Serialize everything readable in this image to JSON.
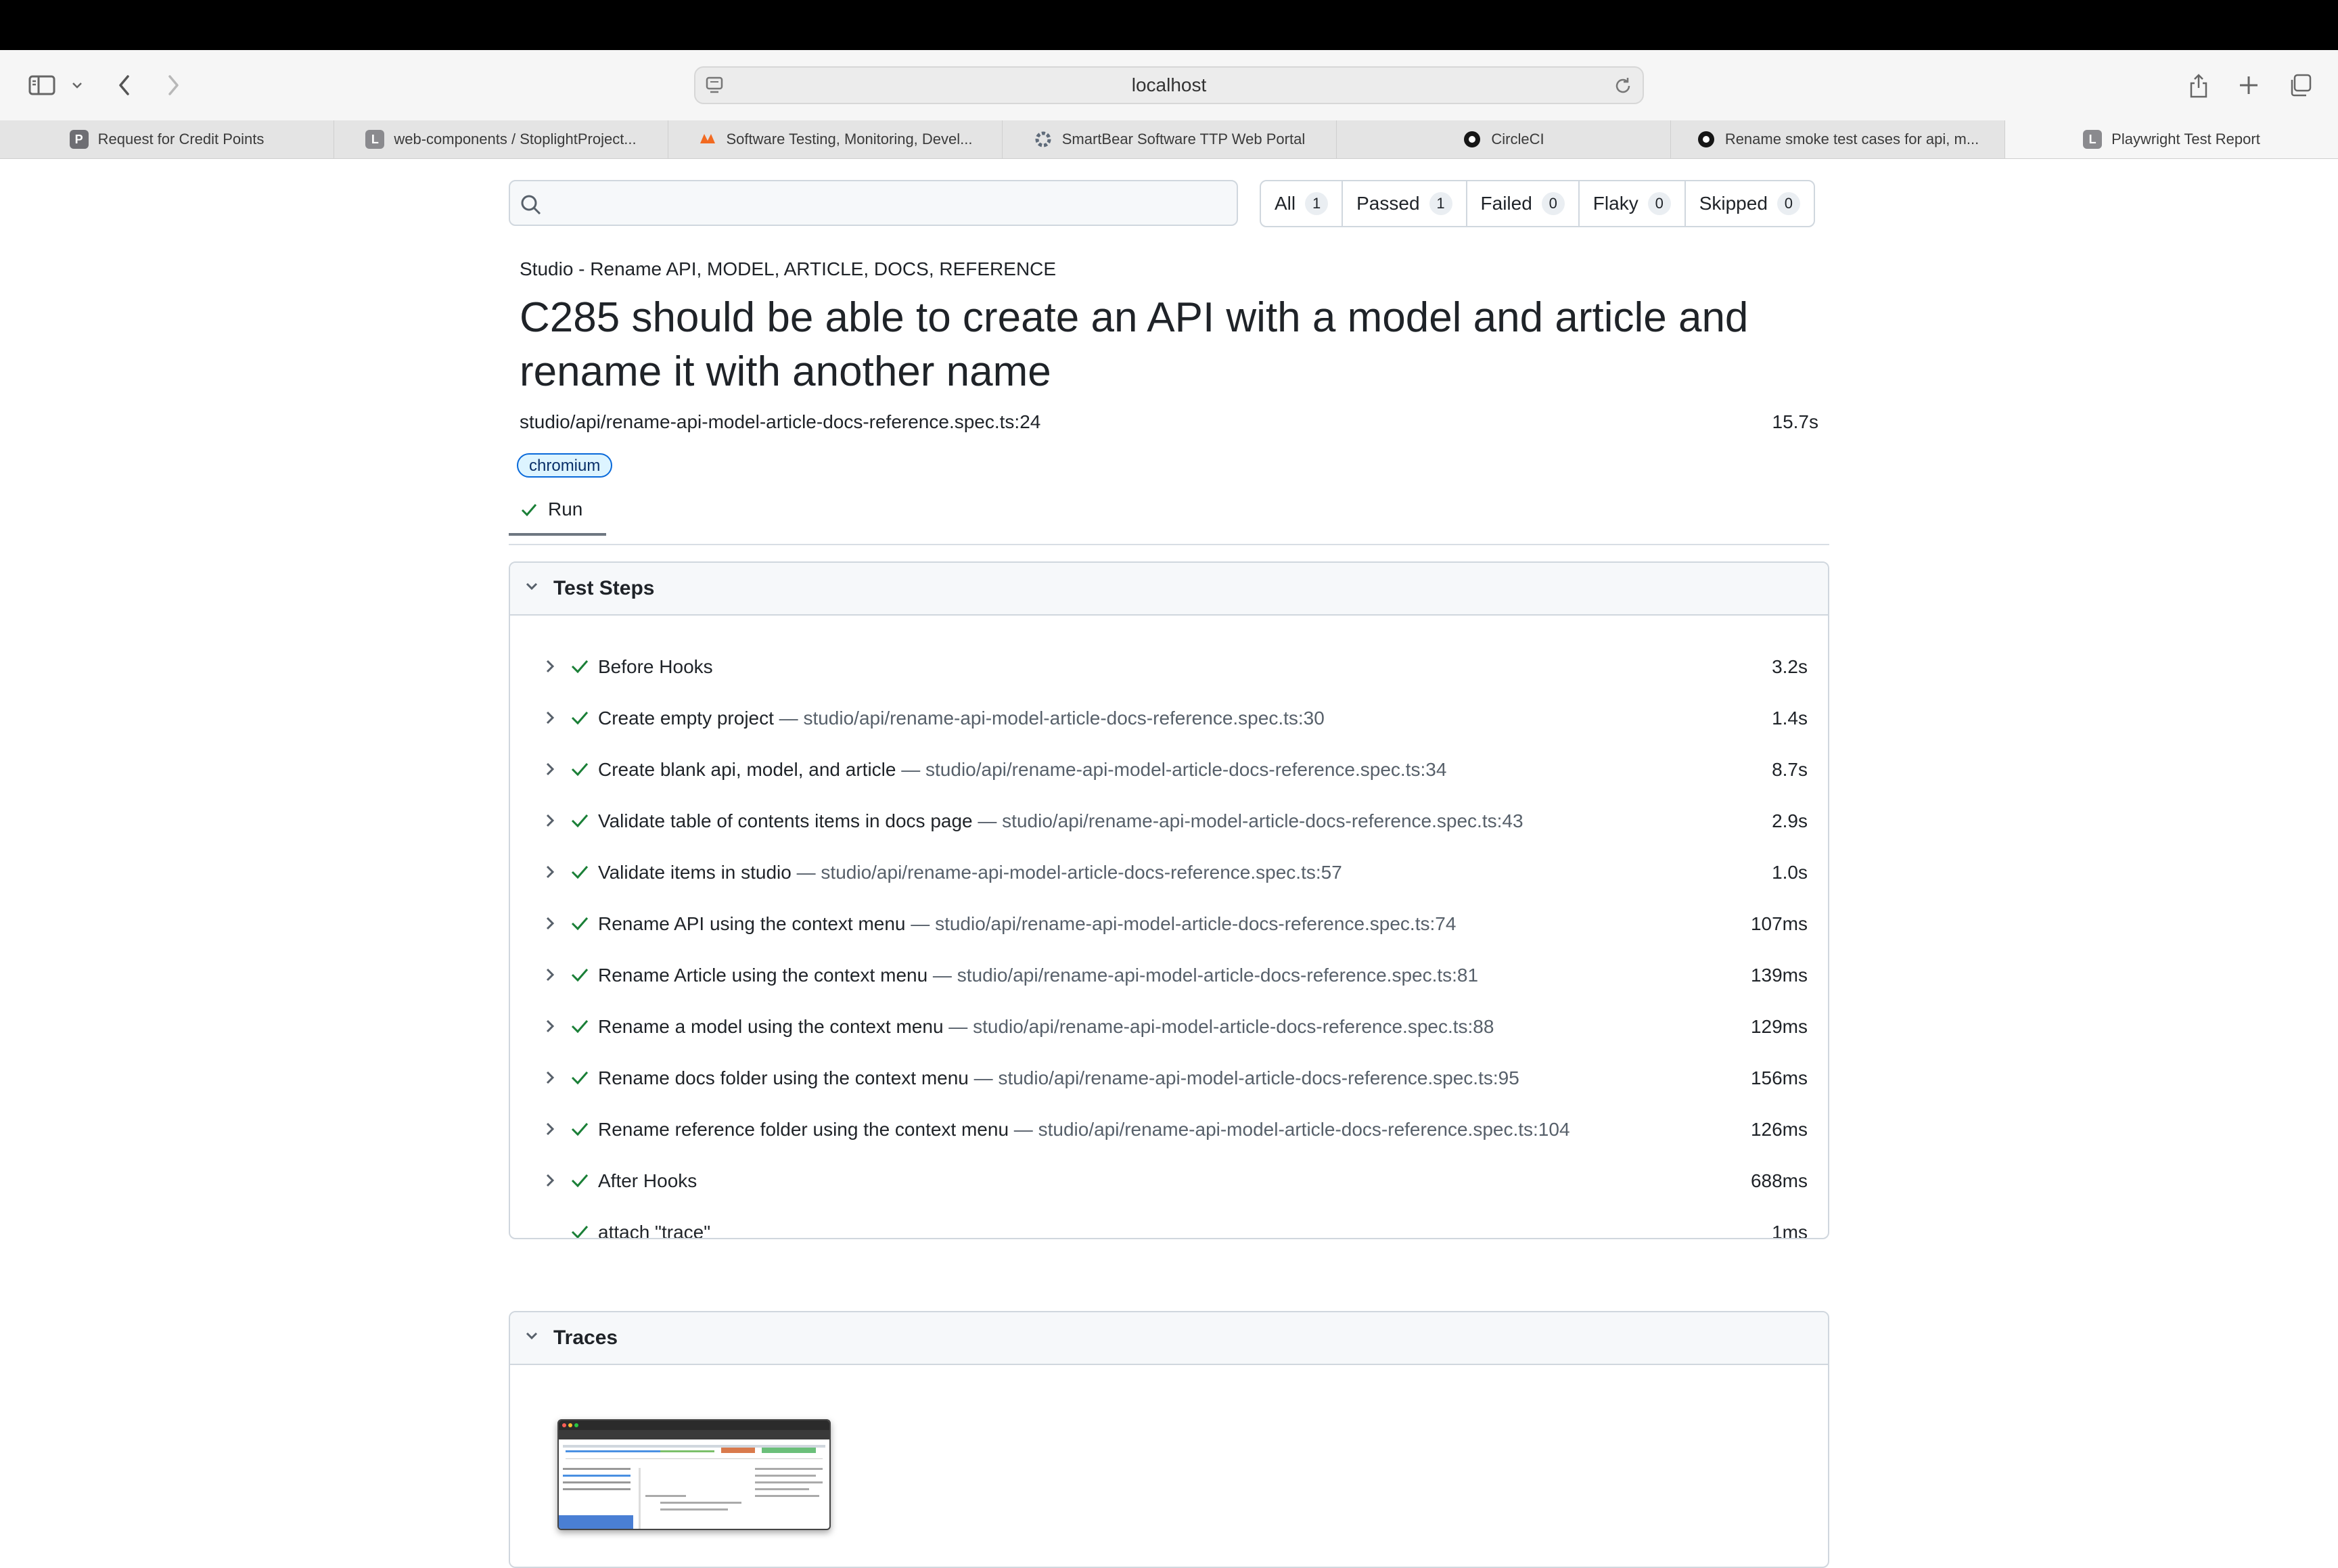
{
  "browser": {
    "address": "localhost",
    "tabs": [
      {
        "label": "Request for Credit Points",
        "favicon": "P",
        "favicon_color": "#6e6e73",
        "active": false
      },
      {
        "label": "web-components / StoplightProject...",
        "favicon": "L",
        "favicon_color": "#8a8a8e",
        "active": false
      },
      {
        "label": "Software Testing, Monitoring, Devel...",
        "favicon": "smartbear-logo",
        "favicon_color": "#f26a21",
        "active": false
      },
      {
        "label": "SmartBear Software TTP Web Portal",
        "favicon": "smartbear-gear",
        "favicon_color": "#5f6b7a",
        "active": false
      },
      {
        "label": "CircleCI",
        "favicon": "circleci-logo",
        "favicon_color": "#161616",
        "active": false
      },
      {
        "label": "Rename smoke test cases for api, m...",
        "favicon": "github-logo",
        "favicon_color": "#161616",
        "active": false
      },
      {
        "label": "Playwright Test Report",
        "favicon": "L",
        "favicon_color": "#8a8a8e",
        "active": true
      }
    ]
  },
  "filters": [
    {
      "label": "All",
      "count": "1"
    },
    {
      "label": "Passed",
      "count": "1"
    },
    {
      "label": "Failed",
      "count": "0"
    },
    {
      "label": "Flaky",
      "count": "0"
    },
    {
      "label": "Skipped",
      "count": "0"
    }
  ],
  "test": {
    "suite": "Studio - Rename API, MODEL, ARTICLE, DOCS, REFERENCE",
    "title": "C285 should be able to create an API with a model and article and rename it with another name",
    "location": "studio/api/rename-api-model-article-docs-reference.spec.ts:24",
    "duration": "15.7s",
    "tag": "chromium",
    "run_tab": "Run"
  },
  "steps_panel": {
    "title": "Test Steps",
    "steps": [
      {
        "name": "Before Hooks",
        "location": "",
        "duration": "3.2s",
        "expandable": true
      },
      {
        "name": "Create empty project",
        "location": "studio/api/rename-api-model-article-docs-reference.spec.ts:30",
        "duration": "1.4s",
        "expandable": true
      },
      {
        "name": "Create blank api, model, and article",
        "location": "studio/api/rename-api-model-article-docs-reference.spec.ts:34",
        "duration": "8.7s",
        "expandable": true
      },
      {
        "name": "Validate table of contents items in docs page",
        "location": "studio/api/rename-api-model-article-docs-reference.spec.ts:43",
        "duration": "2.9s",
        "expandable": true
      },
      {
        "name": "Validate items in studio",
        "location": "studio/api/rename-api-model-article-docs-reference.spec.ts:57",
        "duration": "1.0s",
        "expandable": true
      },
      {
        "name": "Rename API using the context menu",
        "location": "studio/api/rename-api-model-article-docs-reference.spec.ts:74",
        "duration": "107ms",
        "expandable": true
      },
      {
        "name": "Rename Article using the context menu",
        "location": "studio/api/rename-api-model-article-docs-reference.spec.ts:81",
        "duration": "139ms",
        "expandable": true
      },
      {
        "name": "Rename a model using the context menu",
        "location": "studio/api/rename-api-model-article-docs-reference.spec.ts:88",
        "duration": "129ms",
        "expandable": true
      },
      {
        "name": "Rename docs folder using the context menu",
        "location": "studio/api/rename-api-model-article-docs-reference.spec.ts:95",
        "duration": "156ms",
        "expandable": true
      },
      {
        "name": "Rename reference folder using the context menu",
        "location": "studio/api/rename-api-model-article-docs-reference.spec.ts:104",
        "duration": "126ms",
        "expandable": true
      },
      {
        "name": "After Hooks",
        "location": "",
        "duration": "688ms",
        "expandable": true
      },
      {
        "name": "attach \"trace\"",
        "location": "",
        "duration": "1ms",
        "expandable": false
      }
    ]
  },
  "traces_panel": {
    "title": "Traces"
  },
  "colors": {
    "pass": "#1a7f37",
    "tag_border": "#0969da",
    "tag_bg": "#ddf4ff",
    "muted_text": "#57606a"
  }
}
